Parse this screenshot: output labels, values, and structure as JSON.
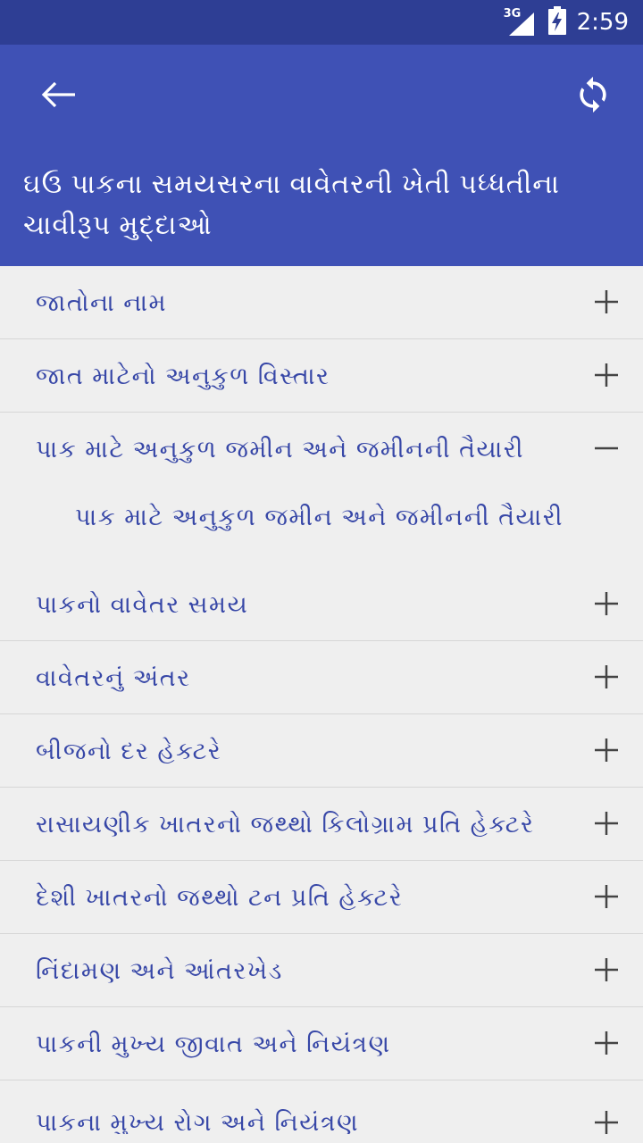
{
  "status_bar": {
    "network": "3G",
    "time": "2:59"
  },
  "app_bar": {
    "back_icon": "arrow-left-icon",
    "refresh_icon": "refresh-icon",
    "title": "ઘઉ પાકના સમયસરના વાવેતરની ખેતી પધ્ધતીના ચાવીરૂપ મુદ્દાઓ"
  },
  "list": {
    "items": [
      {
        "label": "જાતોના નામ",
        "state": "collapsed"
      },
      {
        "label": "જાત માટેનો અનુકુળ વિસ્તાર",
        "state": "collapsed"
      },
      {
        "label": "પાક માટે અનુકુળ જમીન અને જમીનની તૈયારી",
        "state": "expanded",
        "child": "પાક માટે અનુકુળ જમીન અને જમીનની તૈયારી"
      },
      {
        "label": "પાકનો વાવેતર સમય",
        "state": "collapsed"
      },
      {
        "label": "વાવેતરનું અંતર",
        "state": "collapsed"
      },
      {
        "label": "બીજનો દર હેક્ટરે",
        "state": "collapsed"
      },
      {
        "label": "રાસાયણીક ખાતરનો જથ્થો કિલોગ્રામ પ્રતિ હેક્ટરે",
        "state": "collapsed"
      },
      {
        "label": "દેશી ખાતરનો જથ્થો ટન પ્રતિ હેક્ટરે",
        "state": "collapsed"
      },
      {
        "label": "નિંદામણ અને આંતરખેડ",
        "state": "collapsed"
      },
      {
        "label": "પાકની મુખ્ય જીવાત અને નિયંત્રણ",
        "state": "collapsed"
      },
      {
        "label": "પાકના મુખ્ય રોગ અને નિયંત્રણ",
        "state": "collapsed"
      }
    ]
  },
  "colors": {
    "status_bar": "#2e3e94",
    "app_bar": "#3f51b5",
    "text": "#3747a7",
    "background": "#efefef",
    "divider": "#d6d6d6"
  }
}
